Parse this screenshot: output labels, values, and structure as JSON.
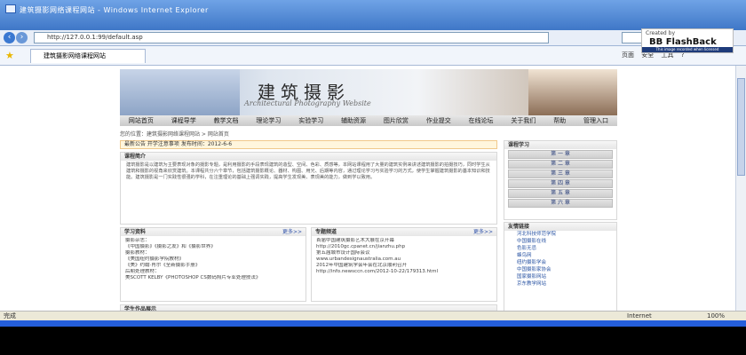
{
  "window": {
    "title": "建筑摄影网络课程网站 - Windows Internet Explorer"
  },
  "browser": {
    "url": "http://127.0.0.1:99/default.asp",
    "tab_label": "建筑摄影网络课程网站",
    "tools": [
      "页面",
      "安全",
      "工具",
      "?"
    ],
    "status_left": "完成",
    "status_zone": "Internet",
    "zoom": "100%"
  },
  "overlay": {
    "header": "Created by",
    "title": "BB FlashBack",
    "sub": "This image recorded when licensed"
  },
  "site": {
    "title": "建筑摄影",
    "subtitle": "Architectural Photography Website",
    "menu": [
      "网站首页",
      "课程导学",
      "教学文档",
      "理论学习",
      "实验学习",
      "辅助资源",
      "图片欣赏",
      "作业提交",
      "在线论坛",
      "关于我们",
      "帮助",
      "管理入口"
    ],
    "breadcrumb": "您的位置：建筑摄影网络课程网站 > 网站首页",
    "notice": "最新公告   开学注意事项   发布时间：2012-6-6",
    "intro": {
      "title": "课程简介",
      "text": "建筑摄影是以建筑为主要表现对象的摄影专题，是利用摄影的手段表现建筑的造型、空间、色彩、质感等，本网站课程用了大量的建筑实例来讲述建筑摄影的拍摄技巧，同时学生从建筑和摄影的视角来欣赏建筑。本课程共分六个章节，包括建筑摄影概论、器材、构图、用光、后期等内容，通过理论学习与实验学习的方式，使学生掌握建筑摄影的基本知识和技能。建筑摄影是一门实践性很强的学科，在注重理论的基础上强调实践，提高学生发现美、表现美的能力，做到学以致用。"
    },
    "study": {
      "title": "学习资料",
      "more": "更多>>",
      "items": [
        "摄影杂志：",
        "《中国摄影》《摄影之友》和《摄影世界》",
        "摄影教材：",
        "《美国纽约摄影学院教材》",
        "《美》约翰·肖尔《全新摄影手册》",
        "后期处理教材：",
        "美SCOTT KELBY《PHOTOSHOP CS数码照片专业处理技法》"
      ]
    },
    "topic": {
      "title": "专题频道",
      "more": "更多>>",
      "items": [
        "首届中国建筑摄影艺术大展在京开幕",
        "http://2010gc.cpanet.cn/jianzhu.php",
        "第五届城市设计国际会议",
        "www.urbandesignaustralia.com.au",
        "2012年中国建筑学会年会在北京顺利召开",
        "http://info.newsccn.com/2012-10-22/179313.html"
      ]
    },
    "gallery_title": "学生作品展示",
    "learn": {
      "title": "课程学习",
      "chapters": [
        "第 一 章",
        "第 二 章",
        "第 三 章",
        "第 四 章",
        "第 五 章",
        "第 六 章"
      ]
    },
    "links": {
      "title": "友情链接",
      "items": [
        "河北科技师范学院",
        "中国摄影在线",
        "色影无忌",
        "蜂鸟网",
        "纽约摄影学会",
        "中国摄影家协会",
        "国家摄影网站",
        "京东教学网站"
      ]
    }
  }
}
